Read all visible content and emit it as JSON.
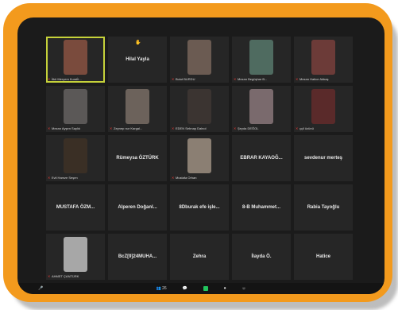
{
  "tiles": [
    {
      "label": "İlkü Meryem Kuralİi...",
      "name": "",
      "video": "#7a4b3d",
      "active": true
    },
    {
      "label": "",
      "name": "Hilal Yayla",
      "video": "",
      "hand": true
    },
    {
      "label": "Bulut BURDU",
      "name": "",
      "video": "#6b5b52"
    },
    {
      "label": "Mezan Begüşhar B...",
      "name": "",
      "video": "#4f6b60"
    },
    {
      "label": "Mezan Hatice Akbaş",
      "name": "",
      "video": "#6c3b38"
    },
    {
      "label": "Mezan Ayşen Saylık",
      "name": "",
      "video": "#5b5857"
    },
    {
      "label": "Zeynep nur Kargal...",
      "name": "",
      "video": "#6c625b"
    },
    {
      "label": "EDEN Sebnap Dalnol",
      "name": "",
      "video": "#3b3431"
    },
    {
      "label": "Şeyda DEĞOL",
      "name": "",
      "video": "#7a6a6d"
    },
    {
      "label": "ççil özünü",
      "name": "",
      "video": "#5a2a2a"
    },
    {
      "label": "Evli Hamze Seşen",
      "name": "",
      "video": "#3a2f25"
    },
    {
      "label": "",
      "name": "Rümeysa ÖZTÜRK",
      "video": ""
    },
    {
      "label": "Mustafa Orhan",
      "name": "",
      "video": "#8b7f73"
    },
    {
      "label": "",
      "name": "EBRAR KAYAOĞ...",
      "video": ""
    },
    {
      "label": "",
      "name": "sevdenur merteş",
      "video": ""
    },
    {
      "label": "",
      "name": "MUSTAFA ÖZM...",
      "video": ""
    },
    {
      "label": "",
      "name": "Alperen Doğanl...",
      "video": ""
    },
    {
      "label": "",
      "name": "8Dburak efe işle...",
      "video": ""
    },
    {
      "label": "",
      "name": "8-B Muhammet...",
      "video": ""
    },
    {
      "label": "",
      "name": "Rabia Tayoğlu",
      "video": ""
    },
    {
      "label": "AHMET ÇANTÜRK",
      "name": "",
      "video": "#a7a7a7"
    },
    {
      "label": "",
      "name": "BcZ[9]24MUHA...",
      "video": ""
    },
    {
      "label": "",
      "name": "Zehra",
      "video": ""
    },
    {
      "label": "",
      "name": "İlayda Ö.",
      "video": ""
    },
    {
      "label": "",
      "name": "Hatice",
      "video": ""
    }
  ],
  "toolbar": {
    "participants_count": "26"
  }
}
